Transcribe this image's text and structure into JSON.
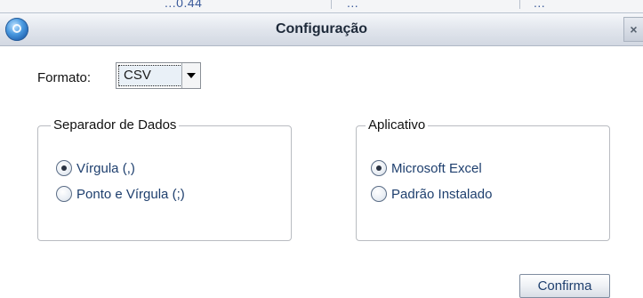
{
  "background_fragments": [
    "...0.44",
    "...",
    "..."
  ],
  "dialog": {
    "title": "Configuração",
    "close_label": "×",
    "app_icon": "app-globe-icon"
  },
  "format": {
    "label": "Formato:",
    "selected": "CSV"
  },
  "separator_group": {
    "title": "Separador de Dados",
    "options": [
      {
        "label": "Vírgula (,)",
        "checked": true
      },
      {
        "label": "Ponto e Vírgula (;)",
        "checked": false
      }
    ]
  },
  "application_group": {
    "title": "Aplicativo",
    "options": [
      {
        "label": "Microsoft Excel",
        "checked": true
      },
      {
        "label": "Padrão Instalado",
        "checked": false
      }
    ]
  },
  "confirm_label": "Confirma",
  "colors": {
    "title_text": "#1e2a3a",
    "link_text": "#1e3f6e",
    "group_border": "#b9bcc1"
  }
}
